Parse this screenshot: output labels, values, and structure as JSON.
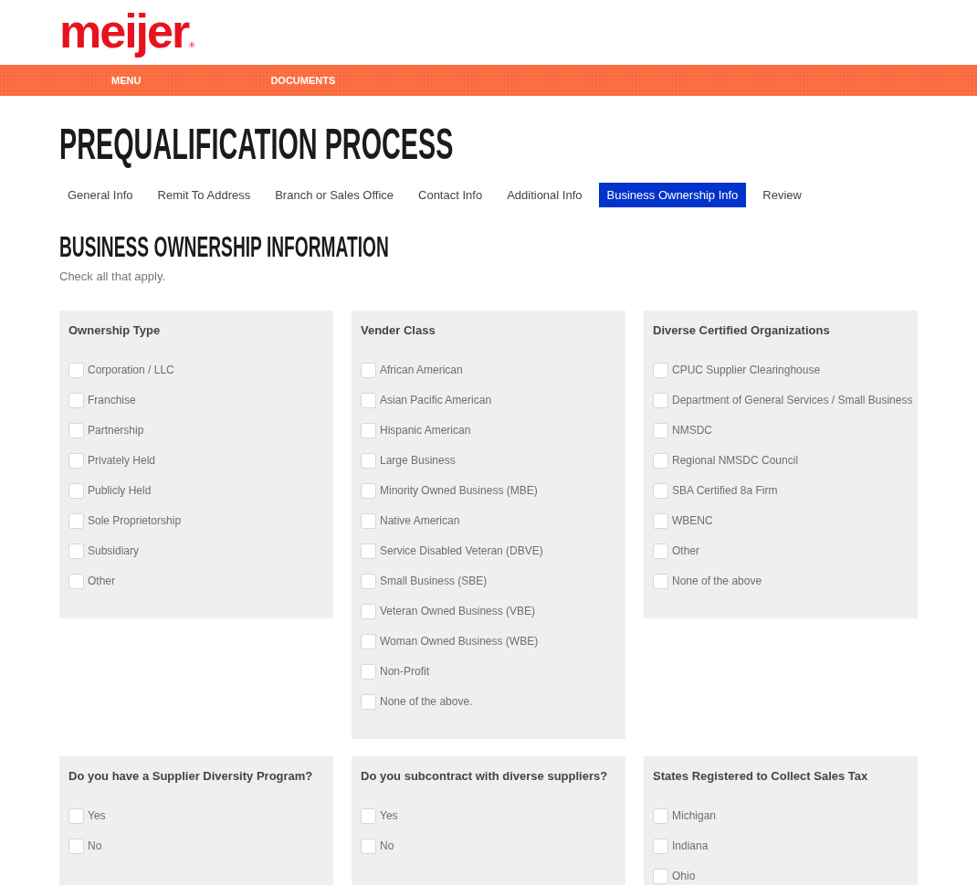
{
  "logo": {
    "text": "meijer",
    "mark": "®"
  },
  "nav": [
    "MENU",
    "DOCUMENTS"
  ],
  "page_title": "PREQUALIFICATION PROCESS",
  "tabs": [
    {
      "label": "General Info",
      "selected": false
    },
    {
      "label": "Remit To Address",
      "selected": false
    },
    {
      "label": "Branch or Sales Office",
      "selected": false
    },
    {
      "label": "Contact Info",
      "selected": false
    },
    {
      "label": "Additional Info",
      "selected": false
    },
    {
      "label": "Business Ownership Info",
      "selected": true
    },
    {
      "label": "Review",
      "selected": false
    }
  ],
  "section": {
    "heading": "BUSINESS OWNERSHIP INFORMATION",
    "instruction": "Check all that apply."
  },
  "groups": [
    {
      "title": "Ownership Type",
      "options": [
        {
          "label": "Corporation / LLC",
          "checked": false
        },
        {
          "label": "Franchise",
          "checked": false
        },
        {
          "label": "Partnership",
          "checked": false
        },
        {
          "label": "Privately Held",
          "checked": false
        },
        {
          "label": "Publicly Held",
          "checked": false
        },
        {
          "label": "Sole Proprietorship",
          "checked": false
        },
        {
          "label": "Subsidiary",
          "checked": false
        },
        {
          "label": "Other",
          "checked": false
        }
      ]
    },
    {
      "title": "Vender Class",
      "options": [
        {
          "label": "African American",
          "checked": false
        },
        {
          "label": "Asian Pacific American",
          "checked": false
        },
        {
          "label": "Hispanic American",
          "checked": false
        },
        {
          "label": "Large Business",
          "checked": false
        },
        {
          "label": "Minority Owned Business (MBE)",
          "checked": false
        },
        {
          "label": "Native American",
          "checked": false
        },
        {
          "label": "Service Disabled Veteran (DBVE)",
          "checked": false
        },
        {
          "label": "Small Business (SBE)",
          "checked": false
        },
        {
          "label": "Veteran Owned Business (VBE)",
          "checked": false
        },
        {
          "label": "Woman Owned Business (WBE)",
          "checked": false
        },
        {
          "label": "Non-Profit",
          "checked": false
        },
        {
          "label": "None of the above.",
          "checked": false
        }
      ]
    },
    {
      "title": "Diverse Certified Organizations",
      "options": [
        {
          "label": "CPUC Supplier Clearinghouse",
          "checked": false
        },
        {
          "label": "Department of General Services / Small Business",
          "checked": false
        },
        {
          "label": "NMSDC",
          "checked": false
        },
        {
          "label": "Regional NMSDC Council",
          "checked": false
        },
        {
          "label": "SBA Certified 8a Firm",
          "checked": false
        },
        {
          "label": "WBENC",
          "checked": false
        },
        {
          "label": "Other",
          "checked": false
        },
        {
          "label": "None of the above",
          "checked": false
        }
      ]
    },
    {
      "title": "Do you have a Supplier Diversity Program?",
      "options": [
        {
          "label": "Yes",
          "checked": false
        },
        {
          "label": "No",
          "checked": false
        }
      ]
    },
    {
      "title": "Do you subcontract with diverse suppliers?",
      "options": [
        {
          "label": "Yes",
          "checked": false
        },
        {
          "label": "No",
          "checked": false
        }
      ]
    },
    {
      "title": "States Registered to Collect Sales Tax",
      "options": [
        {
          "label": "Michigan",
          "checked": false
        },
        {
          "label": "Indiana",
          "checked": false
        },
        {
          "label": "Ohio",
          "checked": false
        }
      ]
    }
  ]
}
